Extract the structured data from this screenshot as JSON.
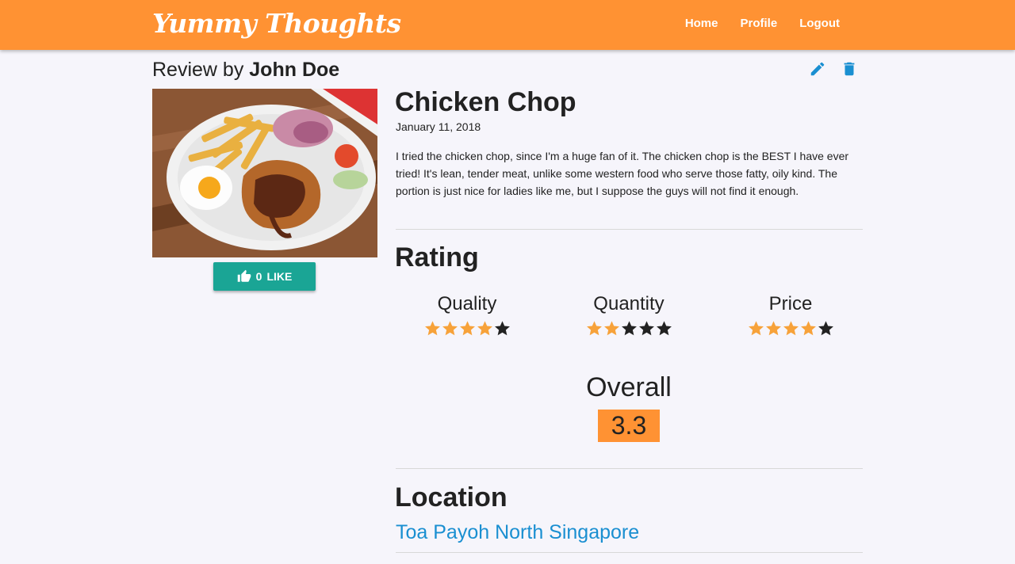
{
  "header": {
    "brand": "Yummy Thoughts",
    "nav": [
      "Home",
      "Profile",
      "Logout"
    ],
    "color": "#ff9233"
  },
  "review": {
    "prefix": "Review by",
    "author": "John Doe",
    "dish": "Chicken Chop",
    "date": "January 11, 2018",
    "text": "I tried the chicken chop, since I'm a huge fan of it. The chicken chop is the BEST I have ever tried! It's lean, tender meat, unlike some western food who serve those fatty, oily kind. The portion is just nice for ladies like me, but I suppose the guys will not find it enough.",
    "like_count": "0",
    "like_label": "LIKE"
  },
  "rating": {
    "title": "Rating",
    "items": [
      {
        "label": "Quality",
        "stars": 4,
        "max": 5
      },
      {
        "label": "Quantity",
        "stars": 2,
        "max": 5
      },
      {
        "label": "Price",
        "stars": 4,
        "max": 5
      }
    ],
    "overall_label": "Overall",
    "overall_value": "3.3"
  },
  "location": {
    "title": "Location",
    "place": "Toa Payoh North Singapore"
  },
  "icons": {
    "edit": "edit-icon",
    "delete": "delete-icon",
    "like": "thumbs-up-icon",
    "star_filled_color": "#f7a23a",
    "star_empty_color": "#222222",
    "accent": "#1a8fd1",
    "like_button_color": "#1aa595"
  }
}
